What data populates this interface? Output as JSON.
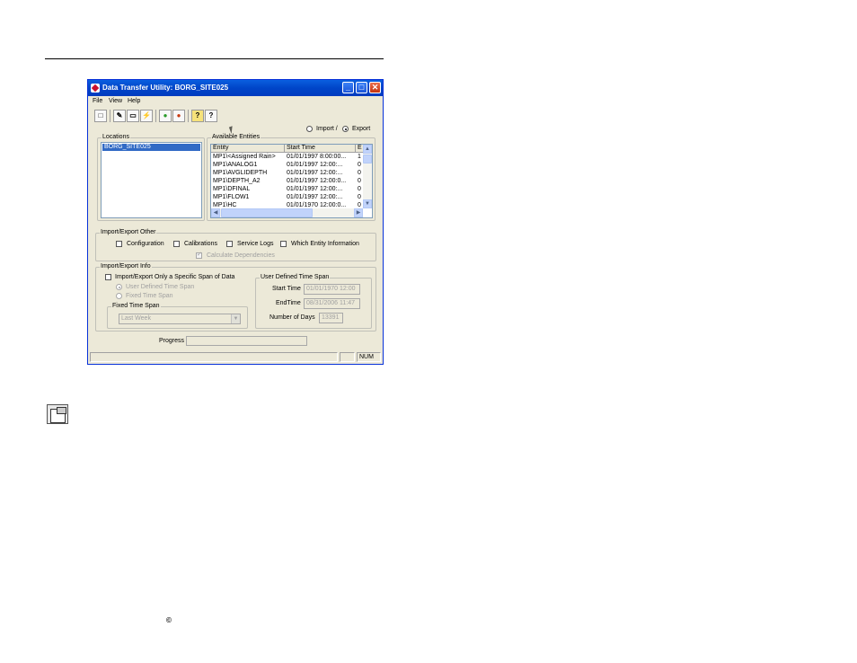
{
  "window": {
    "title": "Data Transfer Utility: BORG_SITE025",
    "minimize_glyph": "_",
    "maximize_glyph": "□",
    "close_glyph": "✕"
  },
  "menu": {
    "items": [
      "File",
      "View",
      "Help"
    ]
  },
  "toolbar": {
    "icons": [
      "new-icon",
      "properties-icon",
      "window-icon",
      "lightning-icon",
      "go-icon",
      "stop-icon",
      "help-icon",
      "context-help-icon"
    ],
    "glyphs": [
      "□",
      "✎",
      "▭",
      "⚡",
      "●",
      "●",
      "?",
      "?"
    ]
  },
  "direction": {
    "import_label": "Import /",
    "export_label": "Export",
    "selected": "export"
  },
  "locations": {
    "label": "Locations",
    "items": [
      "BORG_SITE025"
    ],
    "selected_index": 0
  },
  "entities": {
    "label": "Available Entities",
    "columns": [
      "Entity",
      "Start Time",
      "E"
    ],
    "rows": [
      [
        "MP1\\<Assigned Rain>",
        "01/01/1997 8:00:00...",
        "1"
      ],
      [
        "MP1\\ANALOG1",
        "01/01/1997 12:00:...",
        "0"
      ],
      [
        "MP1\\AVGLIDEPTH",
        "01/01/1997 12:00:...",
        "0"
      ],
      [
        "MP1\\DEPTH_A2",
        "01/01/1997 12:00:0...",
        "0"
      ],
      [
        "MP1\\DFINAL",
        "01/01/1997 12:00:...",
        "0"
      ],
      [
        "MP1\\FLOW1",
        "01/01/1997 12:00:...",
        "0"
      ],
      [
        "MP1\\HC",
        "01/01/1970 12:00:0...",
        "0"
      ]
    ]
  },
  "other": {
    "label": "Import/Export Other",
    "configuration": "Configuration",
    "calibrations": "Calibrations",
    "service_logs": "Service Logs",
    "which_entity": "Which Entity Information",
    "calculate_dependencies": "Calculate Dependencies"
  },
  "info": {
    "label": "Import/Export Info",
    "specific_span": "Import/Export Only a Specific Span of Data",
    "user_defined_option": "User Defined Time Span",
    "fixed_option": "Fixed Time Span",
    "fixed_group_label": "Fixed Time Span",
    "fixed_value": "Last Week",
    "user_group_label": "User Defined Time Span",
    "start_label": "Start Time",
    "start_value": "01/01/1970 12:00",
    "end_label": "EndTime",
    "end_value": "08/31/2006 11:47",
    "days_label": "Number of Days",
    "days_value": "13391"
  },
  "progress": {
    "label": "Progress",
    "value": 0
  },
  "status": {
    "num": "NUM"
  },
  "copyright": "©"
}
